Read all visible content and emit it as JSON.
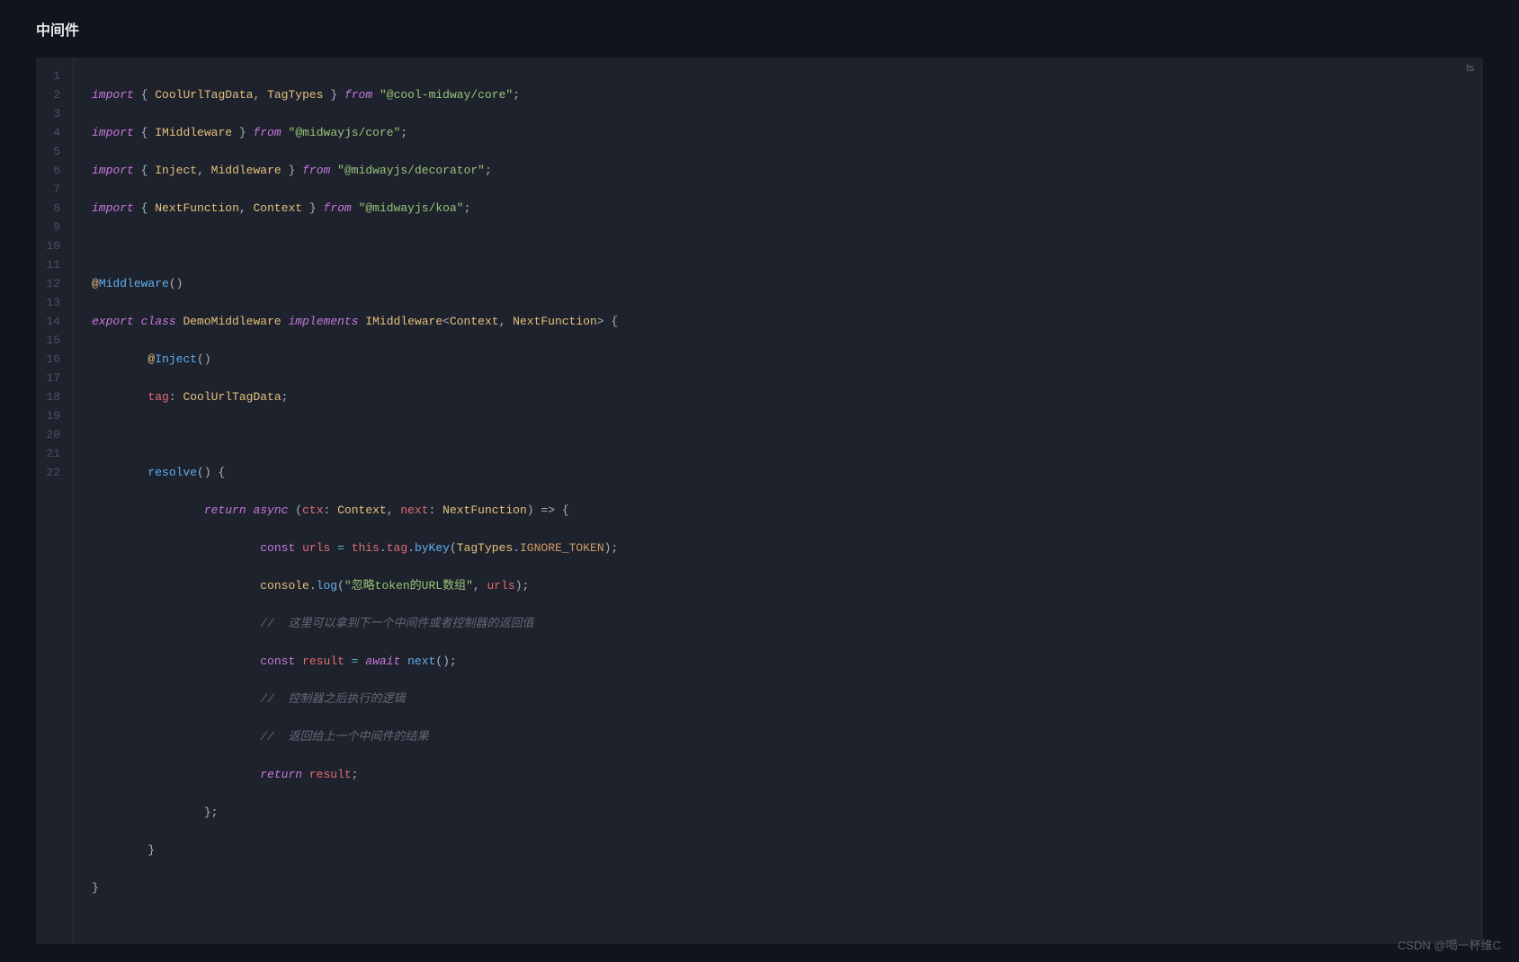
{
  "heading": "中间件",
  "lang": "ts",
  "watermark": "CSDN @喝一杯维C",
  "lines": {
    "n1": "1",
    "n2": "2",
    "n3": "3",
    "n4": "4",
    "n5": "5",
    "n6": "6",
    "n7": "7",
    "n8": "8",
    "n9": "9",
    "n10": "10",
    "n11": "11",
    "n12": "12",
    "n13": "13",
    "n14": "14",
    "n15": "15",
    "n16": "16",
    "n17": "17",
    "n18": "18",
    "n19": "19",
    "n20": "20",
    "n21": "21",
    "n22": "22"
  },
  "tok": {
    "import": "import",
    "from": "from",
    "export": "export",
    "class": "class",
    "implements": "implements",
    "return": "return",
    "async": "async",
    "await": "await",
    "const": "const",
    "this": "this",
    "CoolUrlTagData": "CoolUrlTagData",
    "TagTypes": "TagTypes",
    "IMiddleware": "IMiddleware",
    "Inject": "Inject",
    "Middleware": "Middleware",
    "NextFunction": "NextFunction",
    "Context": "Context",
    "DemoMiddleware": "DemoMiddleware",
    "tag": "tag",
    "resolve": "resolve",
    "ctx": "ctx",
    "next": "next",
    "urls": "urls",
    "byKey": "byKey",
    "IGNORE_TOKEN": "IGNORE_TOKEN",
    "console": "console",
    "log": "log",
    "result": "result",
    "s_cool": "\"@cool-midway/core\"",
    "s_core": "\"@midwayjs/core\"",
    "s_dec": "\"@midwayjs/decorator\"",
    "s_koa": "\"@midwayjs/koa\"",
    "s_log": "\"忽略token的URL数组\"",
    "c1": "//  这里可以拿到下一个中间件或者控制器的返回值",
    "c2": "//  控制器之后执行的逻辑",
    "c3": "//  返回给上一个中间件的结果",
    "lb": "{",
    "rb": "}",
    "lp": "(",
    "rp": ")",
    "lt": "<",
    "gt": ">",
    "comma": ", ",
    "semi": ";",
    "colon": ": ",
    "arrow": " => ",
    "eq": " = ",
    "dot": ".",
    "at": "@"
  }
}
